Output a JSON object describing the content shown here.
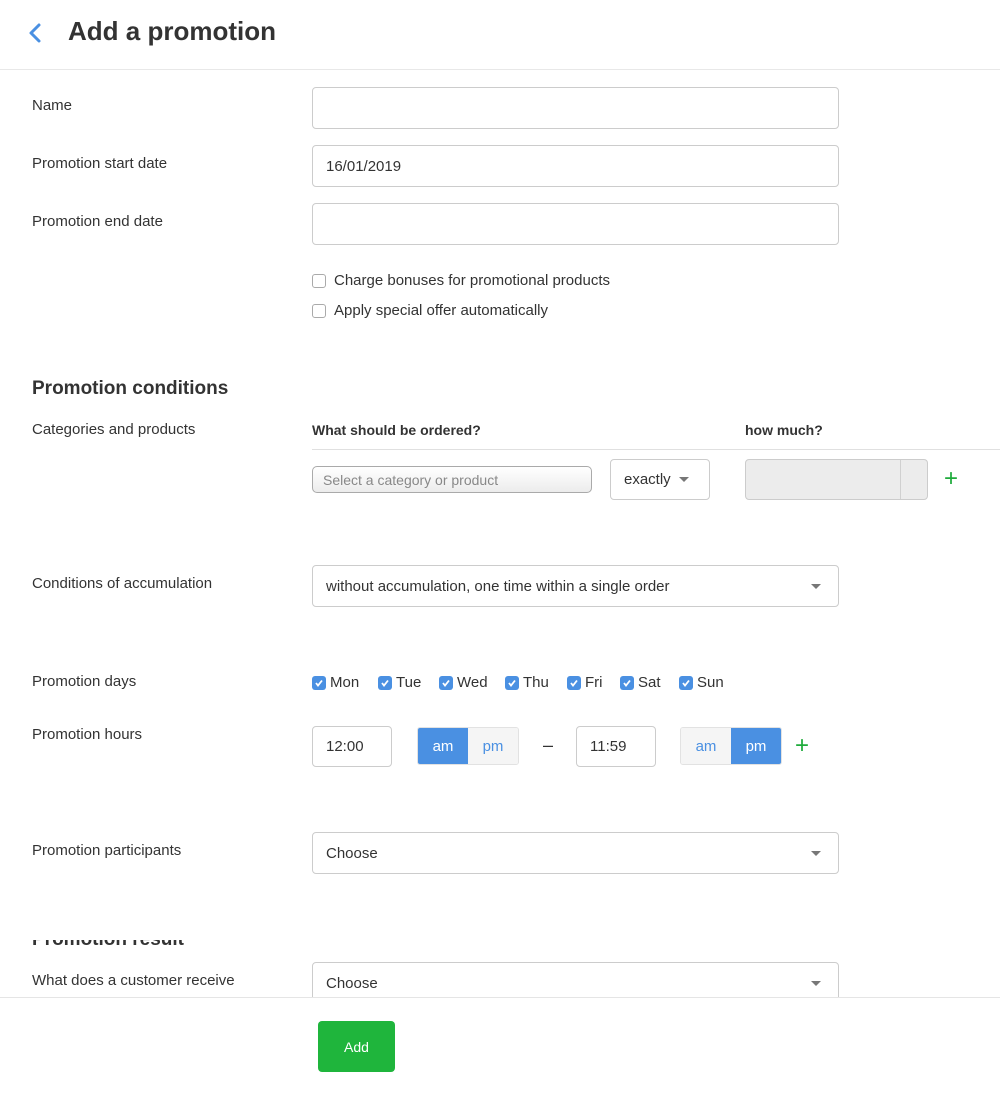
{
  "header": {
    "title": "Add a promotion"
  },
  "form": {
    "name": {
      "label": "Name",
      "value": ""
    },
    "start_date": {
      "label": "Promotion start date",
      "value": "16/01/2019"
    },
    "end_date": {
      "label": "Promotion end date",
      "value": ""
    },
    "checkboxes": [
      {
        "label": "Charge bonuses for promotional products",
        "checked": false
      },
      {
        "label": "Apply special offer automatically",
        "checked": false
      }
    ]
  },
  "conditions": {
    "title": "Promotion conditions",
    "categories_label": "Categories and products",
    "col_what": "What should be ordered?",
    "col_how_much": "how much?",
    "product_placeholder": "Select a category or product",
    "quantity_mode": "exactly",
    "quantity_value": "",
    "accumulation_label": "Conditions of accumulation",
    "accumulation_value": "without accumulation, one time within a single order",
    "days_label": "Promotion days",
    "days": [
      {
        "label": "Mon",
        "checked": true
      },
      {
        "label": "Tue",
        "checked": true
      },
      {
        "label": "Wed",
        "checked": true
      },
      {
        "label": "Thu",
        "checked": true
      },
      {
        "label": "Fri",
        "checked": true
      },
      {
        "label": "Sat",
        "checked": true
      },
      {
        "label": "Sun",
        "checked": true
      }
    ],
    "hours_label": "Promotion hours",
    "hours": {
      "start": "12:00",
      "start_period": "am",
      "end": "11:59",
      "end_period": "pm",
      "am_label": "am",
      "pm_label": "pm",
      "separator": "–"
    },
    "participants_label": "Promotion participants",
    "participants_value": "Choose"
  },
  "result": {
    "title": "Promotion result",
    "receive_label": "What does a customer receive",
    "receive_value": "Choose"
  },
  "footer": {
    "add_label": "Add"
  },
  "colors": {
    "accent": "#4a90e2",
    "success": "#1fb53c",
    "plus": "#1fab3c"
  },
  "icons": {
    "back": "chevron-left-icon",
    "add_row": "plus-icon",
    "dropdown": "caret-down-icon"
  }
}
